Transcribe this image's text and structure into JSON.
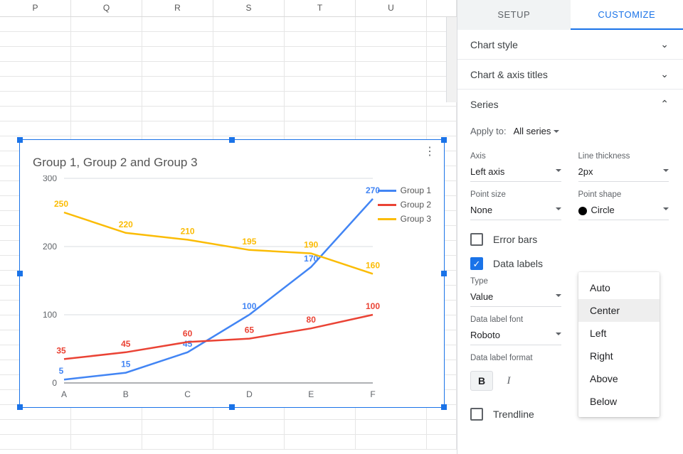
{
  "sheet": {
    "columns": [
      "P",
      "Q",
      "R",
      "S",
      "T",
      "U"
    ]
  },
  "chart_data": {
    "type": "line",
    "title": "Group 1, Group 2 and Group 3",
    "categories": [
      "A",
      "B",
      "C",
      "D",
      "E",
      "F"
    ],
    "series": [
      {
        "name": "Group 1",
        "color": "#4285f4",
        "values": [
          5,
          15,
          45,
          100,
          170,
          270
        ]
      },
      {
        "name": "Group 2",
        "color": "#ea4335",
        "values": [
          35,
          45,
          60,
          65,
          80,
          100
        ]
      },
      {
        "name": "Group 3",
        "color": "#fbbc05",
        "values": [
          250,
          220,
          210,
          195,
          190,
          160
        ]
      }
    ],
    "yticks": [
      0,
      100,
      200,
      300
    ],
    "ylim": [
      0,
      300
    ],
    "xlabel": "",
    "ylabel": ""
  },
  "sidebar": {
    "tabs": {
      "setup": "SETUP",
      "customize": "CUSTOMIZE"
    },
    "sections": {
      "chart_style": "Chart style",
      "chart_axis_titles": "Chart & axis titles",
      "series": "Series"
    },
    "apply_label": "Apply to:",
    "apply_value": "All series",
    "fields": {
      "axis_label": "Axis",
      "axis_value": "Left axis",
      "thick_label": "Line thickness",
      "thick_value": "2px",
      "point_size_label": "Point size",
      "point_size_value": "None",
      "point_shape_label": "Point shape",
      "point_shape_value": "Circle",
      "type_label": "Type",
      "type_value": "Value",
      "font_label": "Data label font",
      "font_value": "Roboto",
      "format_label": "Data label format",
      "fontsize_value": "Auto"
    },
    "checks": {
      "error_bars": "Error bars",
      "data_labels": "Data labels",
      "trendline": "Trendline"
    },
    "position_options": [
      "Auto",
      "Center",
      "Left",
      "Right",
      "Above",
      "Below"
    ],
    "position_selected": "Center"
  }
}
